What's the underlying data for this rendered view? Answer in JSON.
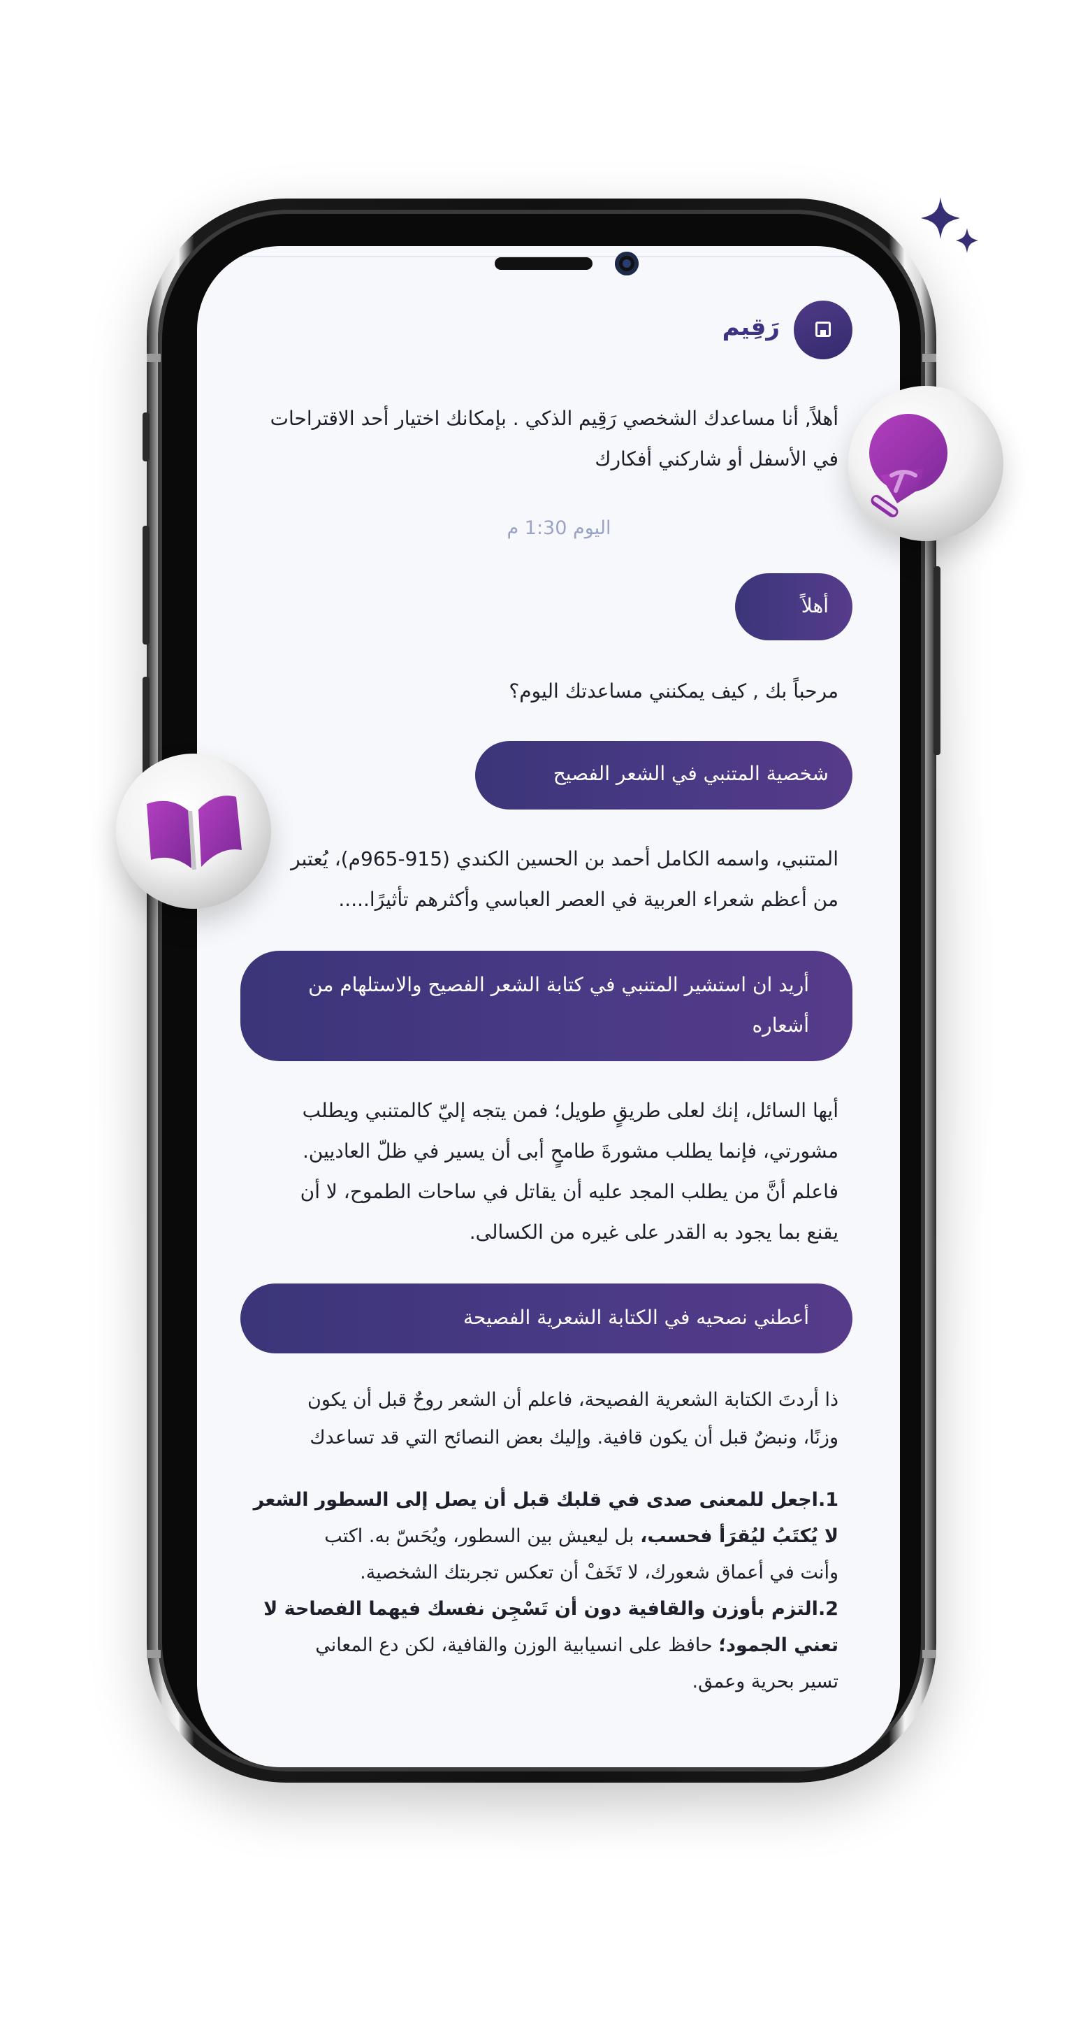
{
  "app": {
    "bot_name": "رَقِيم"
  },
  "icons": {
    "avatar": "document-icon",
    "bulb": "lightbulb-icon",
    "book": "open-book-icon",
    "sparkle": "sparkle-icon"
  },
  "colors": {
    "accent": "#3e3382",
    "bubble": "#463883",
    "badge_icon": "#9a2fb0",
    "timestamp": "#9ba3c4"
  },
  "chat": {
    "welcome_line1": "أهلاً, أنا مساعدك الشخصي رَقِيم الذكي . بإمكانك اختيار أحد الاقتراحات",
    "welcome_line2": "في الأسفل أو شاركني أفكارك",
    "timestamp": "اليوم 1:30 م",
    "user_1": "أهلاً",
    "bot_1": "مرحباً بك , كيف يمكنني مساعدتك اليوم؟",
    "user_2": "شخصية المتنبي في الشعر الفصيح",
    "bot_2_line1": "المتنبي، واسمه الكامل أحمد بن الحسين الكندي (915-965م)، يُعتبر",
    "bot_2_line2": "من أعظم شعراء العربية في العصر العباسي وأكثرهم تأثيرًا.....",
    "user_3_line1": "أريد ان استشير المتنبي في كتابة الشعر الفصيح والاستلهام من",
    "user_3_line2": "أشعاره",
    "bot_3_line1": "أيها السائل، إنك لعلى طريقٍ طويل؛ فمن يتجه إليّ كالمتنبي ويطلب",
    "bot_3_line2": "مشورتي، فإنما يطلب مشورةَ طامحٍ أبى أن يسير في ظلّ العاديين.",
    "bot_3_line3": "فاعلم أنَّ من يطلب المجد عليه أن يقاتل في ساحات الطموح، لا أن",
    "bot_3_line4": "يقنع بما يجود به القدر على غيره من الكسالى.",
    "user_4": "أعطني نصحيه في الكتابة الشعرية الفصيحة",
    "bot_4_line1": "ذا أردتَ الكتابة الشعرية الفصيحة، فاعلم أن الشعر روحٌ قبل أن يكون",
    "bot_4_line2": "وزنًا، ونبضٌ قبل أن يكون قافية. وإليك بعض النصائح التي قد تساعدك",
    "tip1_bold_line1": "1.اجعل للمعنى صدى في قلبك قبل أن يصل إلى السطور الشعر",
    "tip1_bold_line2": "لا يُكتَبُ ليُقرَأ فحسب،",
    "tip1_rest_line2": " بل ليعيش بين السطور، ويُحَسّ به. اكتب",
    "tip1_line3": "وأنت في أعماق شعورك، لا تَخَفْ أن تعكس تجربتك الشخصية.",
    "tip2_bold_line1": "2.التزم بأوزن والقافية دون أن تَسْجِن نفسك فيهما الفصاحة لا",
    "tip2_bold_line2": "تعني الجمود؛",
    "tip2_rest_line2": " حافظ على انسيابية الوزن والقافية، لكن دع المعاني",
    "tip2_line3": "تسير بحرية وعمق."
  }
}
